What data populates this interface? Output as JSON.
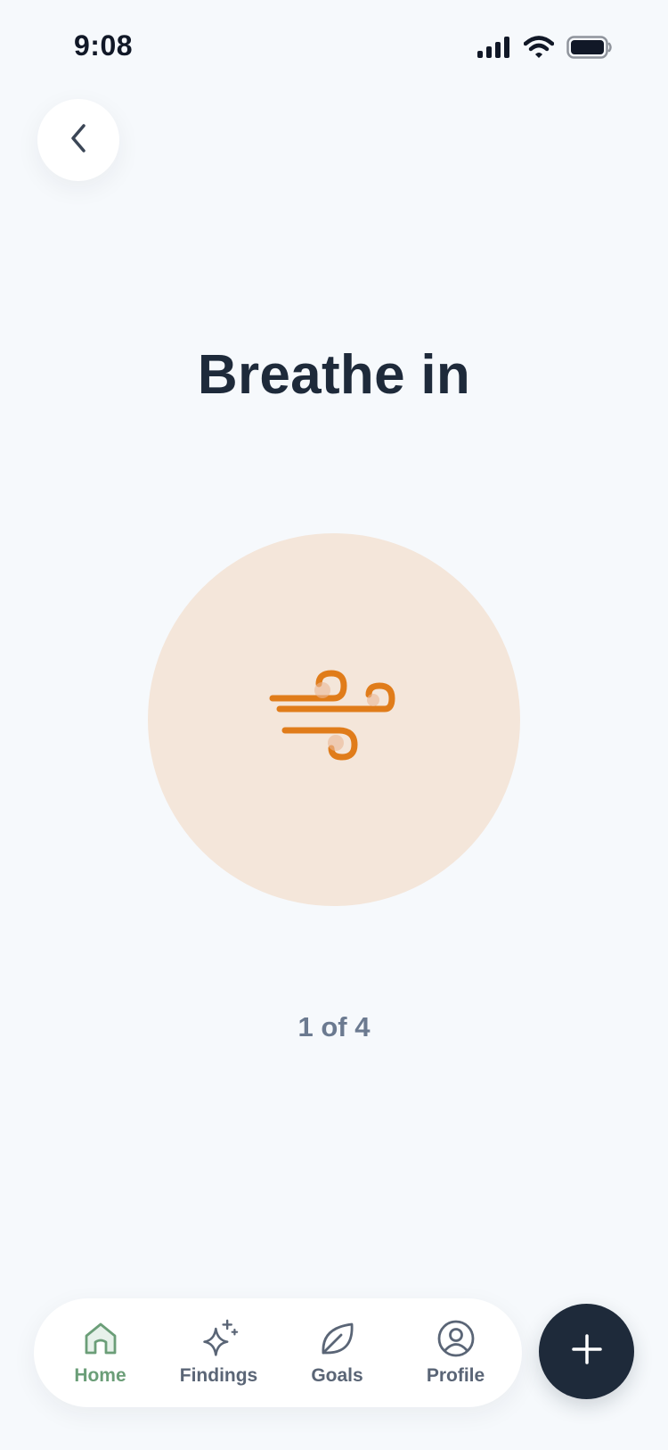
{
  "status_bar": {
    "time": "9:08",
    "icons": [
      "signal-icon",
      "wifi-icon",
      "battery-icon"
    ]
  },
  "header": {
    "back_icon": "chevron-left-icon"
  },
  "exercise": {
    "instruction": "Breathe in",
    "icon": "wind-icon",
    "circle_color": "#F4E6DA",
    "icon_color": "#E07C1A",
    "step_text": "1 of 4"
  },
  "bottom_nav": {
    "active_color": "#6B9E78",
    "items": [
      {
        "label": "Home",
        "icon": "home-icon",
        "active": true
      },
      {
        "label": "Findings",
        "icon": "sparkles-icon",
        "active": false
      },
      {
        "label": "Goals",
        "icon": "leaf-icon",
        "active": false
      },
      {
        "label": "Profile",
        "icon": "user-circle-icon",
        "active": false
      }
    ]
  },
  "fab": {
    "icon": "plus-icon",
    "color": "#1E2A3A"
  }
}
